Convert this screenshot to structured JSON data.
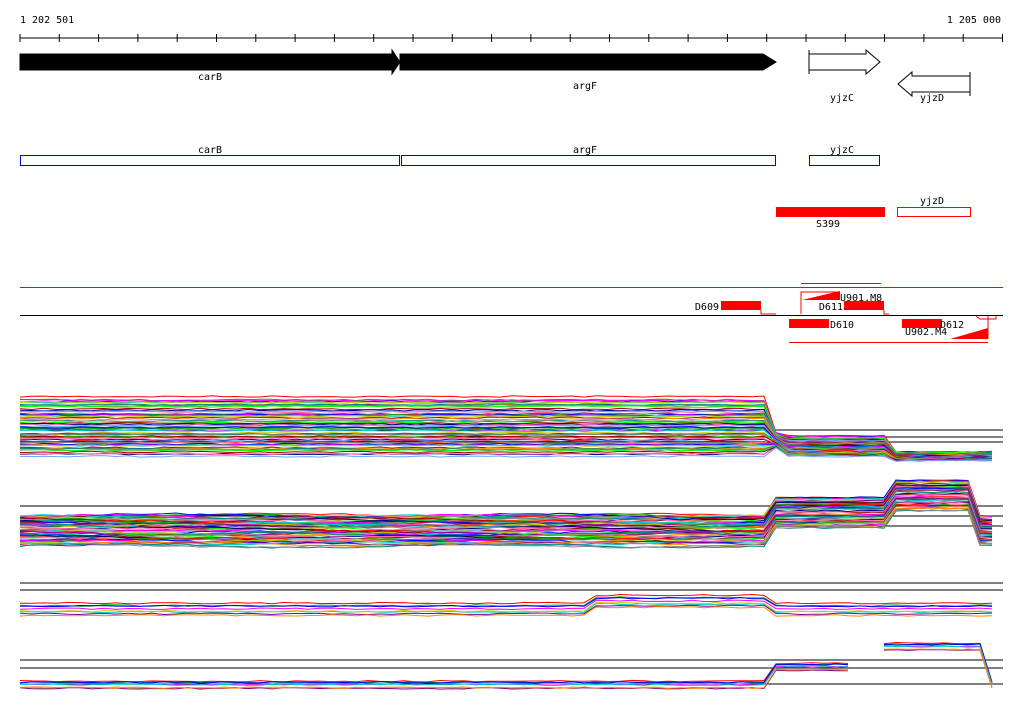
{
  "ruler": {
    "start_label": "1 202 501",
    "end_label": "1 205 000"
  },
  "genes": [
    {
      "id": "carB",
      "label": "carB",
      "strand": "+",
      "fill": "#000000"
    },
    {
      "id": "argF",
      "label": "argF",
      "strand": "+",
      "fill": "#000000"
    },
    {
      "id": "yjzC",
      "label": "yjzC",
      "strand": "+",
      "fill": "#ffffff"
    },
    {
      "id": "yjzD",
      "label": "yjzD",
      "strand": "-",
      "fill": "#ffffff"
    }
  ],
  "cds_track": [
    {
      "label": "carB"
    },
    {
      "label": "argF"
    },
    {
      "label": "yjzC"
    }
  ],
  "segments": [
    {
      "label": "S399",
      "filled": true
    },
    {
      "label": "yjzD",
      "filled": false
    }
  ],
  "features": [
    {
      "label": "D609"
    },
    {
      "label": "U901.M8"
    },
    {
      "label": "D611"
    },
    {
      "label": "D610"
    },
    {
      "label": "D612"
    },
    {
      "label": "U902.M4"
    }
  ],
  "colors": {
    "gene_outline": "#000000",
    "cds_outline": "#0000cc",
    "feature_red": "#ff0000",
    "expression_palette": [
      "#ff0000",
      "#00aa00",
      "#0000ff",
      "#ff00ff",
      "#00cccc",
      "#cccc00",
      "#880088",
      "#ff8800",
      "#008888",
      "#888888",
      "#00ff00",
      "#aa0000",
      "#000088",
      "#ff66aa",
      "#66aaff"
    ]
  }
}
